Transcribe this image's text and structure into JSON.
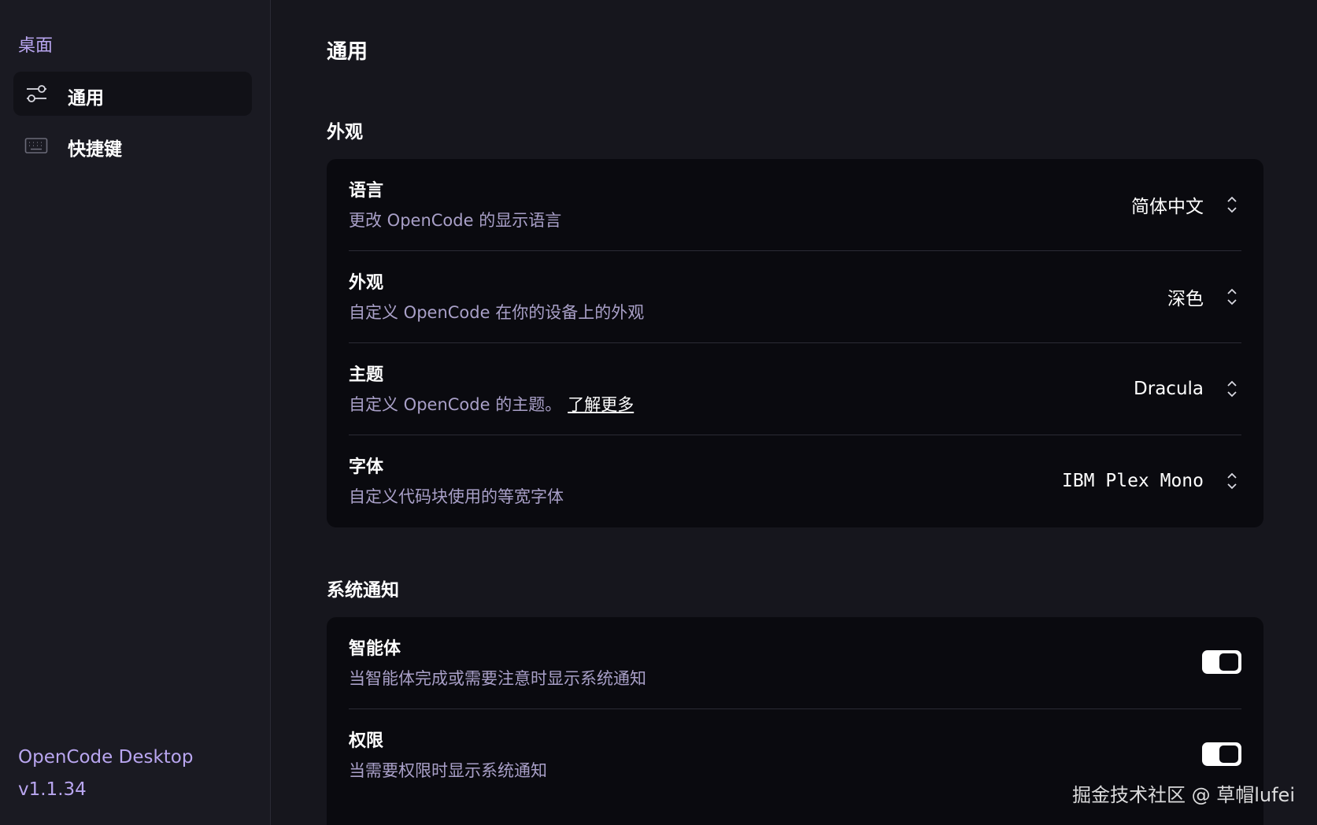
{
  "sidebar": {
    "section_title": "桌面",
    "items": [
      {
        "label": "通用",
        "icon": "sliders-icon",
        "active": true
      },
      {
        "label": "快捷键",
        "icon": "keyboard-icon",
        "active": false
      }
    ],
    "footer": {
      "app_name": "OpenCode Desktop",
      "version": "v1.1.34"
    }
  },
  "main": {
    "page_title": "通用",
    "appearance_section": {
      "title": "外观",
      "rows": [
        {
          "title": "语言",
          "desc": "更改 OpenCode 的显示语言",
          "value": "简体中文"
        },
        {
          "title": "外观",
          "desc": "自定义 OpenCode 在你的设备上的外观",
          "value": "深色"
        },
        {
          "title": "主题",
          "desc": "自定义 OpenCode 的主题。",
          "link": "了解更多",
          "value": "Dracula"
        },
        {
          "title": "字体",
          "desc": "自定义代码块使用的等宽字体",
          "value": "IBM Plex Mono"
        }
      ]
    },
    "notifications_section": {
      "title": "系统通知",
      "rows": [
        {
          "title": "智能体",
          "desc": "当智能体完成或需要注意时显示系统通知",
          "enabled": true
        },
        {
          "title": "权限",
          "desc": "当需要权限时显示系统通知",
          "enabled": true
        }
      ]
    }
  },
  "watermark": "掘金技术社区 @ 草帽lufei",
  "colors": {
    "accent": "#b9a6f0",
    "background": "#16161d",
    "card": "#0a0a0f"
  }
}
